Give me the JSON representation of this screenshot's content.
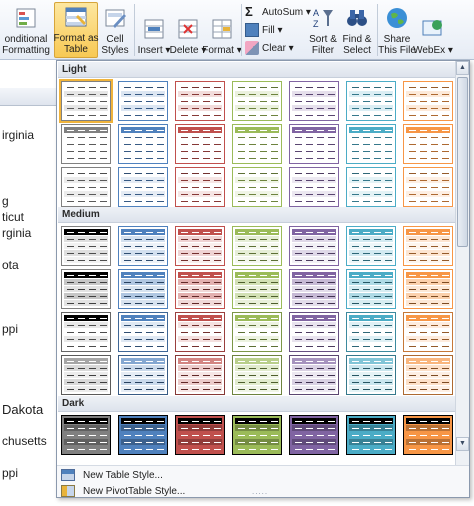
{
  "ribbon": {
    "conditional_formatting": "onditional\nFormatting",
    "format_as_table": "Format as\nTable",
    "cell_styles": "Cell\nStyles",
    "insert": "Insert",
    "delete": "Delete",
    "format": "Format",
    "autosum": "AutoSum",
    "fill": "Fill",
    "clear": "Clear",
    "sort_filter": "Sort &\nFilter",
    "find_select": "Find &\nSelect",
    "share_this_file": "Share\nThis File",
    "webex": "WebEx"
  },
  "sheet": {
    "cells": [
      "irginia",
      "g",
      "ticut",
      "rginia",
      "ota",
      "ppi",
      "Dakota",
      "chusetts",
      "ppi"
    ]
  },
  "gallery": {
    "sections": [
      "Light",
      "Medium",
      "Dark"
    ],
    "colors": {
      "none": "#808080",
      "blue": "#4f81bd",
      "red": "#c0504d",
      "green": "#9bbb59",
      "purple": "#8064a2",
      "aqua": "#4bacc6",
      "orange": "#f79646"
    },
    "scroll_up": "▲",
    "scroll_down": "▼"
  },
  "footer": {
    "new_table_style": "New Table Style...",
    "new_pivottable_style": "New PivotTable Style...",
    "grip": "....."
  },
  "colors": {
    "ribbon_active": "#f8c954",
    "accent_border": "#8b99ad"
  }
}
